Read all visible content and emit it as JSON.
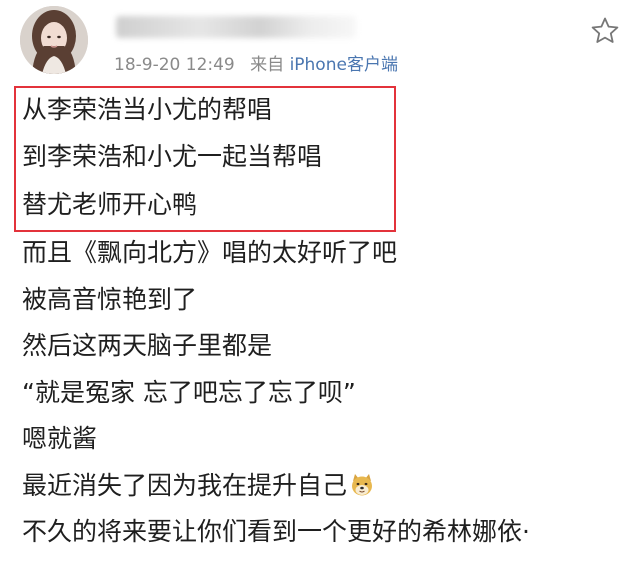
{
  "post": {
    "timestamp": "18-9-20 12:49",
    "source_prefix": "来自",
    "source_name": "iPhone客户端",
    "highlighted_lines": [
      "从李荣浩当小尤的帮唱",
      "到李荣浩和小尤一起当帮唱",
      "替尤老师开心鸭"
    ],
    "lines": [
      "而且《飘向北方》唱的太好听了吧",
      "被高音惊艳到了",
      "然后这两天脑子里都是",
      "“就是冤家 忘了吧忘了忘了呗”",
      "嗯就酱",
      "最近消失了因为我在提升自己",
      "不久的将来要让你们看到一个更好的希林娜依·"
    ],
    "emoji": "doge-emoji",
    "icons": {
      "favorite": "star-outline-icon",
      "avatar": "avatar"
    },
    "colors": {
      "highlight_border": "#e3323b",
      "meta_text": "#8a8a8a",
      "source_link": "#4a76b0"
    }
  }
}
